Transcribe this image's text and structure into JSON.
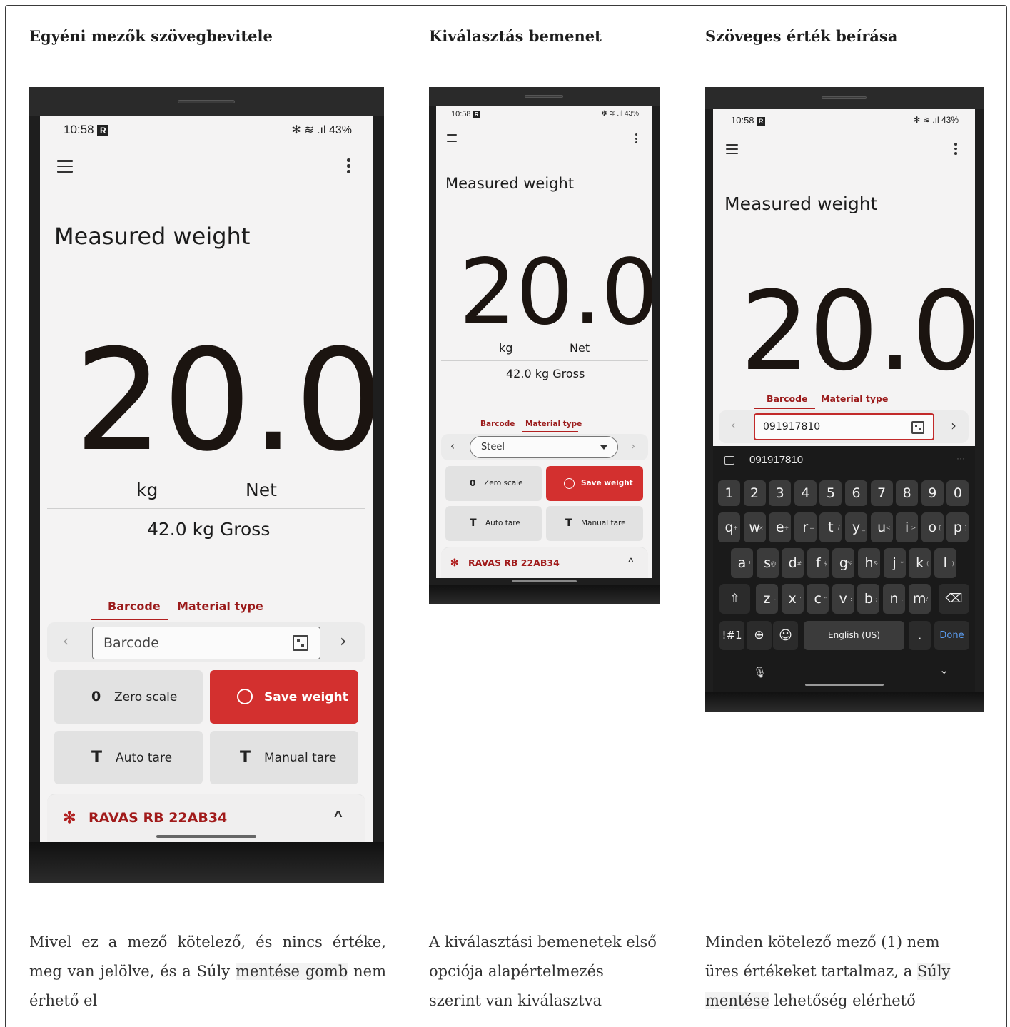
{
  "columns": [
    {
      "title": "Egyéni mezők szövegbevitele",
      "caption_parts": [
        "Mivel ez a mező kötelező, és nincs értéke, meg van jelölve, és a Súly ",
        "mentése gomb",
        " nem érhető el"
      ]
    },
    {
      "title": "Kiválasztás bemenet",
      "caption_parts": [
        "A kiválasztási bemenetek első opciója alapértelmezés szerint van kiválasztva"
      ]
    },
    {
      "title": "Szöveges érték beírása",
      "caption_parts": [
        "Minden kötelező mező (1) nem üres értékeket tartalmaz, a ",
        "Súly mentése",
        " lehetőség elérhető"
      ]
    }
  ],
  "app": {
    "status_time": "10:58",
    "status_r": "R",
    "status_right": "✻ ≋ .ıl 43%",
    "title": "Measured weight",
    "value": "20.0",
    "unit": "kg",
    "mode": "Net",
    "gross": "42.0  kg  Gross",
    "tab_barcode": "Barcode",
    "tab_material": "Material type",
    "barcode_placeholder": "Barcode",
    "material_selected": "Steel",
    "barcode_entered": "091917810",
    "zero_icon": "0",
    "zero_label": "Zero scale",
    "save_label": "Save weight",
    "tare_icon": "T",
    "auto_tare_label": "Auto tare",
    "manual_tare_label": "Manual tare",
    "device_name": "RAVAS RB 22AB34"
  },
  "keyboard": {
    "suggestion": "091917810",
    "row_numbers": [
      "1",
      "2",
      "3",
      "4",
      "5",
      "6",
      "7",
      "8",
      "9",
      "0"
    ],
    "row_q": [
      "q",
      "w",
      "e",
      "r",
      "t",
      "y",
      "u",
      "i",
      "o",
      "p"
    ],
    "row_q_sub": [
      "+",
      "×",
      "÷",
      "=",
      "/",
      "_",
      "<",
      ">",
      "[",
      "]"
    ],
    "row_a": [
      "a",
      "s",
      "d",
      "f",
      "g",
      "h",
      "j",
      "k",
      "l"
    ],
    "row_a_sub": [
      "!",
      "@",
      "#",
      "$",
      "%",
      "&",
      "*",
      "(",
      ")"
    ],
    "row_z": [
      "z",
      "x",
      "c",
      "v",
      "b",
      "n",
      "m"
    ],
    "row_z_sub": [
      "-",
      "'",
      "\"",
      ":",
      ";",
      ",",
      "?"
    ],
    "sym_label": "!#1",
    "space_label": "English (US)",
    "period_label": ".",
    "done_label": "Done"
  },
  "colors": {
    "accent_red": "#d3302f",
    "tab_red": "#9b1b1b"
  }
}
